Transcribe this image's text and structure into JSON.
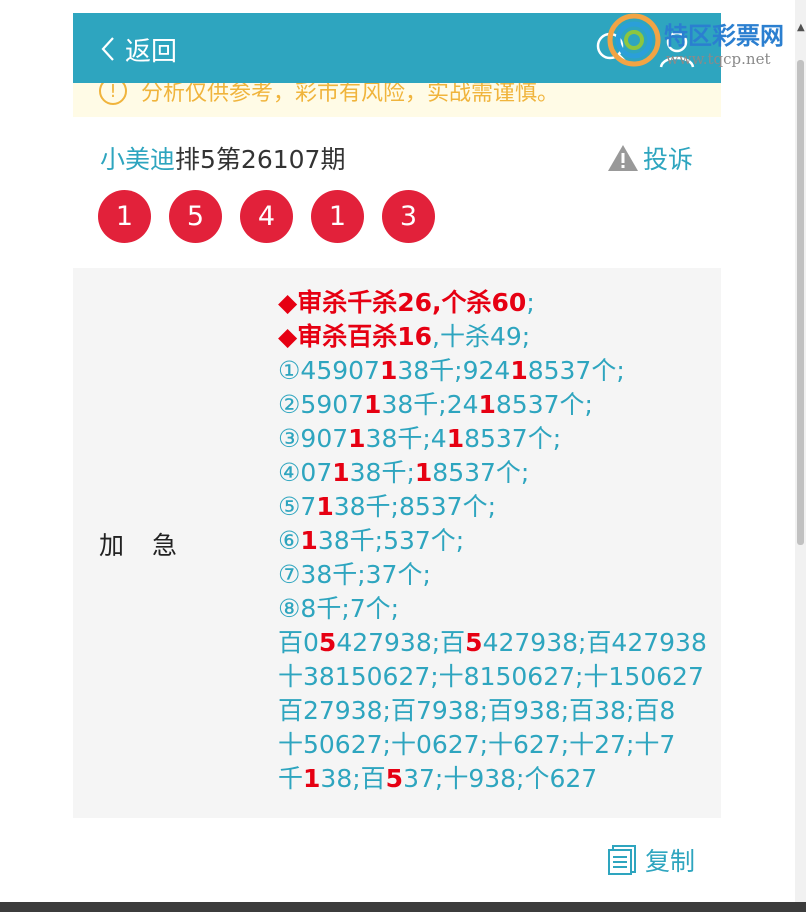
{
  "header": {
    "back_label": "返回"
  },
  "notice": {
    "text": "分析仅供参考，彩市有风险，实战需谨慎。"
  },
  "title": {
    "author": "小美迪",
    "issue": "排5第26107期"
  },
  "complaint_label": "投诉",
  "balls": [
    "1",
    "5",
    "4",
    "1",
    "3"
  ],
  "panel": {
    "label": "加急",
    "lines": [
      [
        {
          "t": "◆审杀千杀26,个杀60",
          "s": "bold-red"
        },
        {
          "t": ";",
          "s": ""
        }
      ],
      [
        {
          "t": "◆审杀百杀16",
          "s": "bold-red"
        },
        {
          "t": ",十杀49;",
          "s": ""
        }
      ],
      [
        {
          "t": "①45907",
          "s": ""
        },
        {
          "t": "1",
          "s": "r"
        },
        {
          "t": "38千;924",
          "s": ""
        },
        {
          "t": "1",
          "s": "r"
        },
        {
          "t": "8537个;",
          "s": ""
        }
      ],
      [
        {
          "t": "②5907",
          "s": ""
        },
        {
          "t": "1",
          "s": "r"
        },
        {
          "t": "38千;24",
          "s": ""
        },
        {
          "t": "1",
          "s": "r"
        },
        {
          "t": "8537个;",
          "s": ""
        }
      ],
      [
        {
          "t": "③907",
          "s": ""
        },
        {
          "t": "1",
          "s": "r"
        },
        {
          "t": "38千;4",
          "s": ""
        },
        {
          "t": "1",
          "s": "r"
        },
        {
          "t": "8537个;",
          "s": ""
        }
      ],
      [
        {
          "t": "④07",
          "s": ""
        },
        {
          "t": "1",
          "s": "r"
        },
        {
          "t": "38千;",
          "s": ""
        },
        {
          "t": "1",
          "s": "r"
        },
        {
          "t": "8537个;",
          "s": ""
        }
      ],
      [
        {
          "t": "⑤7",
          "s": ""
        },
        {
          "t": "1",
          "s": "r"
        },
        {
          "t": "38千;8537个;",
          "s": ""
        }
      ],
      [
        {
          "t": "⑥",
          "s": ""
        },
        {
          "t": "1",
          "s": "r"
        },
        {
          "t": "38千;537个;",
          "s": ""
        }
      ],
      [
        {
          "t": "⑦38千;37个;",
          "s": ""
        }
      ],
      [
        {
          "t": "⑧8千;7个;",
          "s": ""
        }
      ],
      [
        {
          "t": "百0",
          "s": ""
        },
        {
          "t": "5",
          "s": "r"
        },
        {
          "t": "427938;百",
          "s": ""
        },
        {
          "t": "5",
          "s": "r"
        },
        {
          "t": "427938;百427938",
          "s": ""
        }
      ],
      [
        {
          "t": "十38150627;十8150627;十150627",
          "s": ""
        }
      ],
      [
        {
          "t": "百27938;百7938;百938;百38;百8",
          "s": ""
        }
      ],
      [
        {
          "t": "十50627;十0627;十627;十27;十7",
          "s": ""
        }
      ],
      [
        {
          "t": "千",
          "s": ""
        },
        {
          "t": "1",
          "s": "r"
        },
        {
          "t": "38;百",
          "s": ""
        },
        {
          "t": "5",
          "s": "r"
        },
        {
          "t": "37;十938;个627",
          "s": ""
        }
      ]
    ]
  },
  "copy_label": "复制",
  "watermark": {
    "title": "特区彩票网",
    "url": "www.tqcp.net"
  },
  "colors": {
    "header_bg": "#2ea5bf",
    "accent": "#2ea5bf",
    "ball": "#e2213a",
    "highlight": "#e60012",
    "notice_text": "#f0b43c"
  }
}
